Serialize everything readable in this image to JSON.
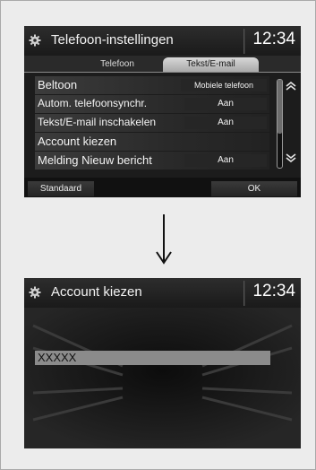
{
  "screen1": {
    "title": "Telefoon-instellingen",
    "time": "12:34",
    "tabs": [
      {
        "label": "Telefoon"
      },
      {
        "label": "Tekst/E-mail"
      }
    ],
    "rows": [
      {
        "label": "Beltoon",
        "value": "Mobiele telefoon"
      },
      {
        "label": "Autom. telefoonsynchr.",
        "value": "Aan"
      },
      {
        "label": "Tekst/E-mail inschakelen",
        "value": "Aan"
      },
      {
        "label": "Account kiezen",
        "value": ""
      },
      {
        "label": "Melding Nieuw bericht",
        "value": "Aan"
      }
    ],
    "buttons": {
      "default": "Standaard",
      "ok": "OK"
    }
  },
  "screen2": {
    "title": "Account kiezen",
    "time": "12:34",
    "items": [
      {
        "label": "XXXXX"
      }
    ]
  },
  "icons": {
    "settings": "gear-icon",
    "scroll_up": "arrow-up-icon",
    "scroll_down": "arrow-down-icon",
    "flow": "down-arrow-icon"
  },
  "colors": {
    "screen_bg": "#1c1c1c",
    "active_tab": "#c4c4c4",
    "selected_item": "#8b8b8b",
    "page_bg": "#ececec"
  }
}
